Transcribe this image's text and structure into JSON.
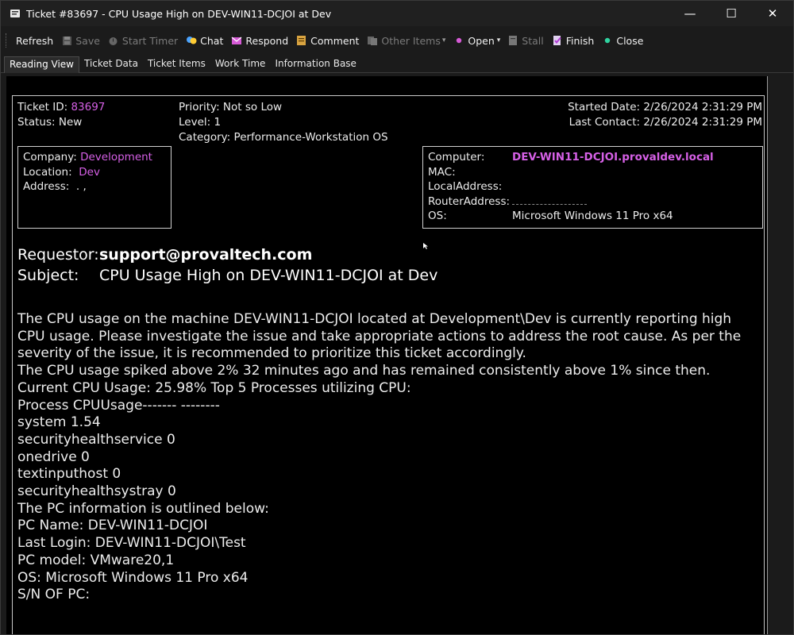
{
  "window": {
    "title": "Ticket #83697 - CPU Usage High on DEV-WIN11-DCJOI at Dev",
    "controls": {
      "minimize": "—",
      "maximize": "☐",
      "close": "✕"
    }
  },
  "toolbar": {
    "refresh": "Refresh",
    "save": "Save",
    "start_timer": "Start Timer",
    "chat": "Chat",
    "respond": "Respond",
    "comment": "Comment",
    "other_items": "Other Items",
    "open": "Open",
    "stall": "Stall",
    "finish": "Finish",
    "close": "Close"
  },
  "tabs": [
    "Reading View",
    "Ticket Data",
    "Ticket Items",
    "Work Time",
    "Information Base"
  ],
  "ticket": {
    "id_label": "Ticket ID:",
    "id": "83697",
    "status_label": "Status:",
    "status": "New",
    "priority_label": "Priority:",
    "priority": "Not so Low",
    "level_label": "Level:",
    "level": "1",
    "category_label": "Category:",
    "category": "Performance-Workstation OS",
    "started_label": "Started Date:",
    "started": "2/26/2024 2:31:29 PM",
    "last_contact_label": "Last Contact:",
    "last_contact": "2/26/2024 2:31:29 PM"
  },
  "client": {
    "company_label": "Company:",
    "company": "Development",
    "location_label": "Location:",
    "location": "Dev",
    "address_label": "Address:",
    "address": ". ,"
  },
  "computer": {
    "computer_label": "Computer:",
    "computer": "DEV-WIN11-DCJOI.provaldev.local",
    "mac_label": "MAC:",
    "mac": "",
    "local_label": "LocalAddress:",
    "local": "",
    "router_label": "RouterAddress:",
    "router": "",
    "os_label": "OS:",
    "os": "Microsoft Windows 11 Pro x64"
  },
  "requestor": {
    "requestor_label": "Requestor:",
    "requestor": "support@provaltech.com",
    "subject_label": "Subject:",
    "subject": "CPU Usage High on DEV-WIN11-DCJOI at Dev"
  },
  "body": {
    "paragraph": " The CPU usage on the machine DEV-WIN11-DCJOI located at Development\\Dev is currently reporting high CPU usage. Please investigate the issue and take appropriate actions to address the root cause. As per the severity of the issue, it is recommended to prioritize this ticket accordingly.",
    "lines": [
      "The CPU usage spiked above 2% 32 minutes ago and has remained consistently above 1% since then.",
      "Current CPU Usage: 25.98% Top 5 Processes utilizing CPU:",
      "Process CPUUsage------- --------",
      "system 1.54",
      "securityhealthservice 0",
      "onedrive 0",
      "textinputhost 0",
      "securityhealthsystray 0",
      "The PC information is outlined below:",
      "PC Name: DEV-WIN11-DCJOI",
      "Last Login: DEV-WIN11-DCJOI\\Test",
      "PC model: VMware20,1",
      "OS: Microsoft Windows 11 Pro x64",
      "S/N OF PC:"
    ]
  },
  "icons": {
    "app": "ticket-app-icon",
    "accent_green": "#2fd3a0",
    "accent_magenta": "#d660e6"
  }
}
